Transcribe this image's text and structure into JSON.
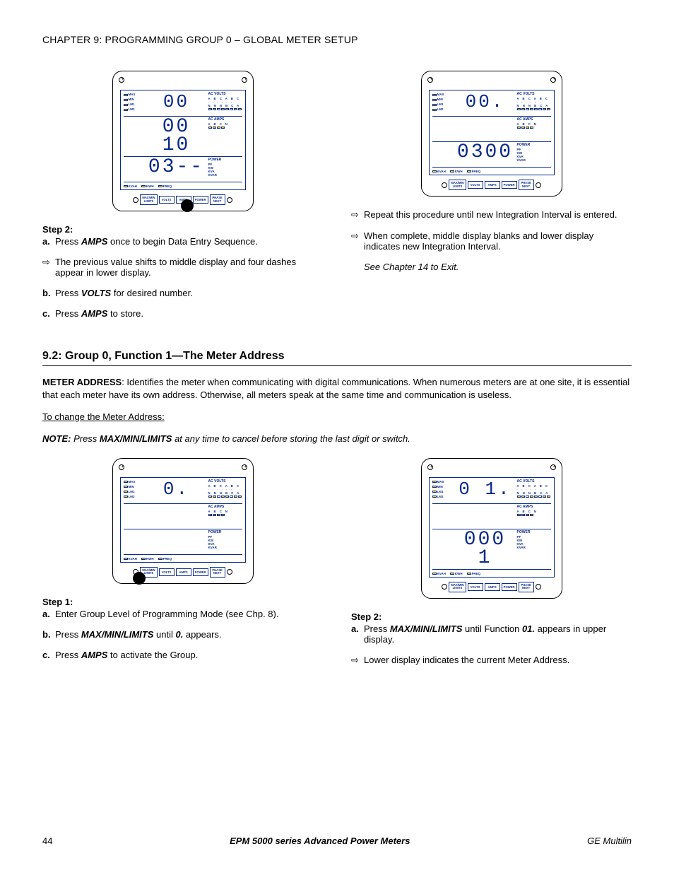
{
  "header": {
    "chapter": "CHAPTER 9: PROGRAMMING GROUP 0 – GLOBAL METER SETUP"
  },
  "meter_labels": {
    "left": [
      "MAX",
      "MIN",
      "LM1",
      "LM2"
    ],
    "ac_volts": "AC VOLTS",
    "volts_letters": "A B C A B C",
    "volts_nn": "N N N B C A",
    "ac_amps": "AC AMPS",
    "amps_letters": "A B C N",
    "power": "POWER",
    "power_items": [
      "PF",
      "KW",
      "KVA",
      "KVAR"
    ],
    "bottom_strip": [
      "KVAH",
      "KWH",
      "FREQ"
    ],
    "buttons": {
      "maxmin": "MAX/MIN\nLIMITS",
      "volts": "VOLTS",
      "amps": "AMPS",
      "power": "POWER",
      "phase": "PHASE\nNEXT"
    }
  },
  "meters": {
    "m1": {
      "top": "00",
      "mid": "00 10",
      "bot": "03--",
      "press": "amps"
    },
    "m2": {
      "top": "00.",
      "mid": "",
      "bot": "0300",
      "press": ""
    },
    "m3": {
      "top": "0.",
      "mid": "",
      "bot": "",
      "press": "maxmin"
    },
    "m4": {
      "top": "0 1.",
      "mid": "",
      "bot": "000 1",
      "press": ""
    }
  },
  "upper_left": {
    "step_head": "Step 2:",
    "a_lbl": "a.",
    "a_txt1": "Press ",
    "a_bold": "AMPS",
    "a_txt2": " once to begin Data Entry Sequence.",
    "arrow_txt": "The previous value shifts to middle display and four dashes appear in lower display.",
    "b_lbl": "b.",
    "b_txt1": "Press ",
    "b_bold": "VOLTS",
    "b_txt2": "  for desired number.",
    "c_lbl": "c.",
    "c_txt1": "Press ",
    "c_bold": "AMPS",
    "c_txt2": " to store."
  },
  "upper_right": {
    "arrow1": "Repeat this procedure until new Integration Interval is entered.",
    "arrow2": " When complete, middle display blanks and lower display indicates new Integration Interval.",
    "see": "See Chapter 14 to Exit."
  },
  "section": {
    "title": "9.2: Group 0, Function 1—The Meter Address",
    "intro_bold": "METER ADDRESS",
    "intro_rest": ": Identifies the meter when communicating with digital communications. When numerous meters are at one site, it is essential that each meter have its own address.  Otherwise, all meters speak at the same time and communication is useless.",
    "change_head": "To change the Meter Address:",
    "note_label": "NOTE: ",
    "note_txt1": "Press ",
    "note_bold": "MAX/MIN/LIMITS",
    "note_txt2": " at any time to cancel before storing the last digit or switch."
  },
  "lower_left": {
    "step_head": "Step 1:",
    "a_lbl": "a.",
    "a_txt": "Enter Group Level of Programming Mode (see Chp. 8).",
    "b_lbl": "b.",
    "b_txt1": "Press ",
    "b_bold": "MAX/MIN/LIMITS",
    "b_txt2": " until ",
    "b_bold2": "0.",
    "b_txt3": " appears.",
    "c_lbl": "c.",
    "c_txt1": "Press ",
    "c_bold": "AMPS",
    "c_txt2": " to activate the Group."
  },
  "lower_right": {
    "step_head": "Step 2:",
    "a_lbl": "a.",
    "a_txt1": "Press ",
    "a_bold": "MAX/MIN/LIMITS",
    "a_txt2": " until Function ",
    "a_bold2": "01.",
    "a_txt3": " appears in upper display.",
    "arrow_txt": " Lower display indicates the current Meter Address."
  },
  "footer": {
    "page": "44",
    "mid": "EPM 5000 series Advanced Power Meters",
    "right": "GE Multilin"
  }
}
